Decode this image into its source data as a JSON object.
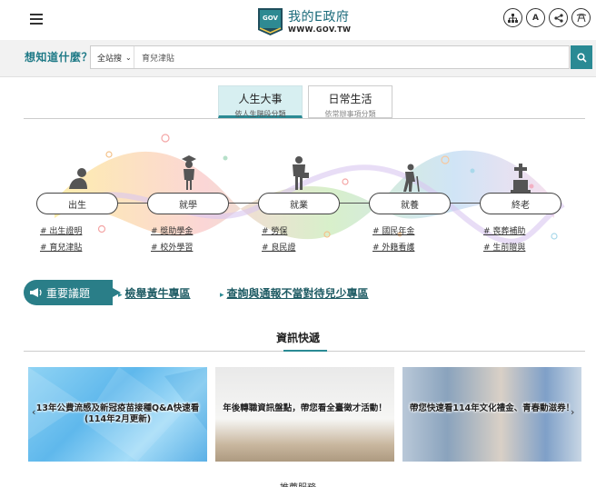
{
  "header": {
    "logo_zh": "我的E政府",
    "logo_en": "WWW.GOV.TW",
    "logo_badge": "GOV",
    "icons": [
      "sitemap-icon",
      "font-size-icon",
      "share-icon",
      "accessibility-icon"
    ],
    "font_btn_label": "A"
  },
  "search": {
    "label": "想知道什麼？",
    "scope": "全站搜",
    "value": "育兒津貼"
  },
  "tabs": [
    {
      "title": "人生大事",
      "subtitle": "依人生階段分類",
      "active": true
    },
    {
      "title": "日常生活",
      "subtitle": "依常辦事項分類",
      "active": false
    }
  ],
  "stages": [
    {
      "label": "出生",
      "links": [
        "# 出生證明",
        "# 育兒津貼"
      ]
    },
    {
      "label": "就學",
      "links": [
        "# 獎助學金",
        "# 校外學習"
      ]
    },
    {
      "label": "就業",
      "links": [
        "# 勞保",
        "# 良民證"
      ]
    },
    {
      "label": "就養",
      "links": [
        "# 國民年金",
        "# 外籍看護"
      ]
    },
    {
      "label": "終老",
      "links": [
        "# 喪葬補助",
        "# 生前贈與"
      ]
    }
  ],
  "issues": {
    "badge": "重要議題",
    "links": [
      "檢舉黃牛專區",
      "查詢與通報不當對待兒少專區"
    ]
  },
  "news": {
    "title": "資訊快遞",
    "cards": [
      "13年公費流感及新冠疫苗接種Q&A快速看(114年2月更新)",
      "年後轉職資訊盤點，帶您看全臺徵才活動！",
      "帶您快速看114年文化禮金、青春動滋券！"
    ],
    "prev": "‹",
    "next": "›"
  },
  "next_section_title": "推薦服務",
  "colors": {
    "accent": "#2a8a94",
    "badge": "#2a7e88",
    "link": "#1e5b64"
  }
}
